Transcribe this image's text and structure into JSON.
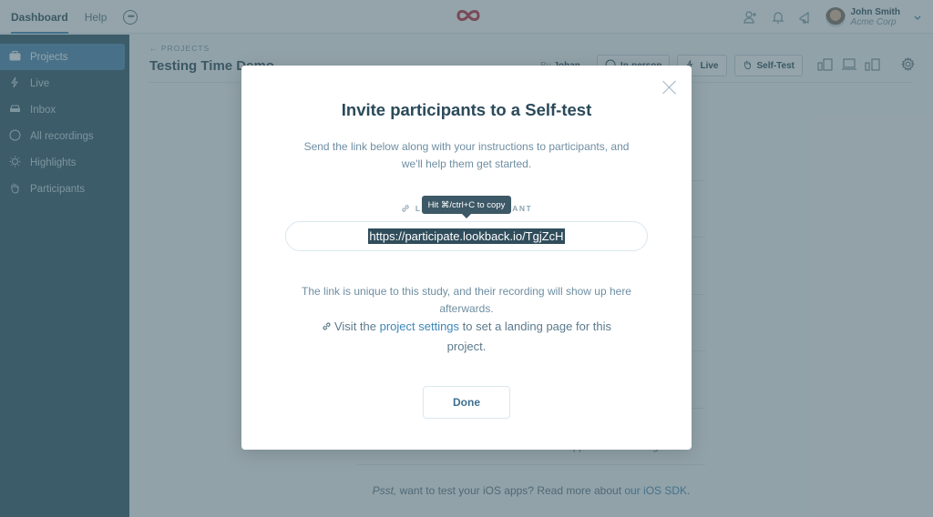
{
  "topbar": {
    "nav": [
      {
        "label": "Dashboard",
        "active": true
      },
      {
        "label": "Help",
        "active": false
      }
    ],
    "more_icon": "ellipsis-circle-icon",
    "logo_icon": "infinity-logo-icon",
    "logo_color": "#c0283b",
    "icons": [
      "add-user-icon",
      "bell-icon",
      "megaphone-icon"
    ],
    "user": {
      "name": "John Smith",
      "org": "Acme Corp"
    }
  },
  "sidebar": {
    "items": [
      {
        "label": "Projects",
        "icon": "briefcase-icon",
        "active": true
      },
      {
        "label": "Live",
        "icon": "lightning-icon",
        "active": false
      },
      {
        "label": "Inbox",
        "icon": "inbox-icon",
        "active": false
      },
      {
        "label": "All recordings",
        "icon": "circle-icon",
        "active": false
      },
      {
        "label": "Highlights",
        "icon": "sun-icon",
        "active": false
      },
      {
        "label": "Participants",
        "icon": "hand-icon",
        "active": false
      }
    ]
  },
  "project": {
    "breadcrumb": "PROJECTS",
    "title": "Testing Time Demo",
    "by_prefix": "By",
    "by_name": "Johan",
    "buttons": [
      {
        "label": "In-person",
        "icon": "person-icon"
      },
      {
        "label": "Live",
        "icon": "lightning-icon"
      },
      {
        "label": "Self-Test",
        "icon": "hand-icon"
      }
    ],
    "bottom_text": "Download the Lookback Android app and start testing.",
    "psst_italic": "Psst,",
    "psst_text": " want to test your iOS apps? Read more about ",
    "psst_link": "our iOS SDK",
    "psst_end": "."
  },
  "modal": {
    "title": "Invite participants to a Self-test",
    "subtitle": "Send the link below along with your instructions to participants, and we'll help them get started.",
    "link_label": "LINK FOR PARTICIPANT",
    "tooltip": "Hit ⌘/ctrl+C to copy",
    "url": "https://participate.lookback.io/TgjZcH",
    "note": "The link is unique to this study, and their recording will show up here afterwards.",
    "visit_prefix": "Visit the ",
    "visit_link": "project settings",
    "visit_suffix": " to set a landing page for this project.",
    "done_label": "Done"
  }
}
